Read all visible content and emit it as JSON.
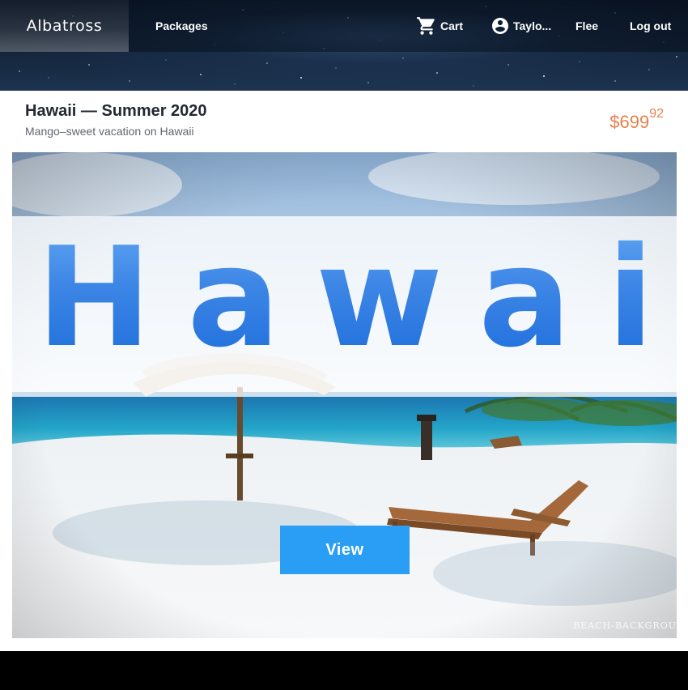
{
  "nav": {
    "brand": "Albatross",
    "packages_label": "Packages",
    "cart_label": "Cart",
    "cart_icon": "shopping-cart-icon",
    "user_label": "Taylo...",
    "user_icon": "account-circle-icon",
    "flee_label": "Flee",
    "logout_label": "Log out"
  },
  "package": {
    "title": "Hawaii — Summer 2020",
    "subtitle": "Mango–sweet vacation on Hawaii",
    "price_currency": "$",
    "price_dollars": "699",
    "price_cents": "92",
    "hero_text": "Hawaii",
    "view_label": "View",
    "watermark": "BEACH-BACKGROU"
  },
  "colors": {
    "accent": "#2a9df4",
    "price": "#e8814d",
    "hero_text": "#3d86e6",
    "navbar_bg": "#0b1424"
  }
}
